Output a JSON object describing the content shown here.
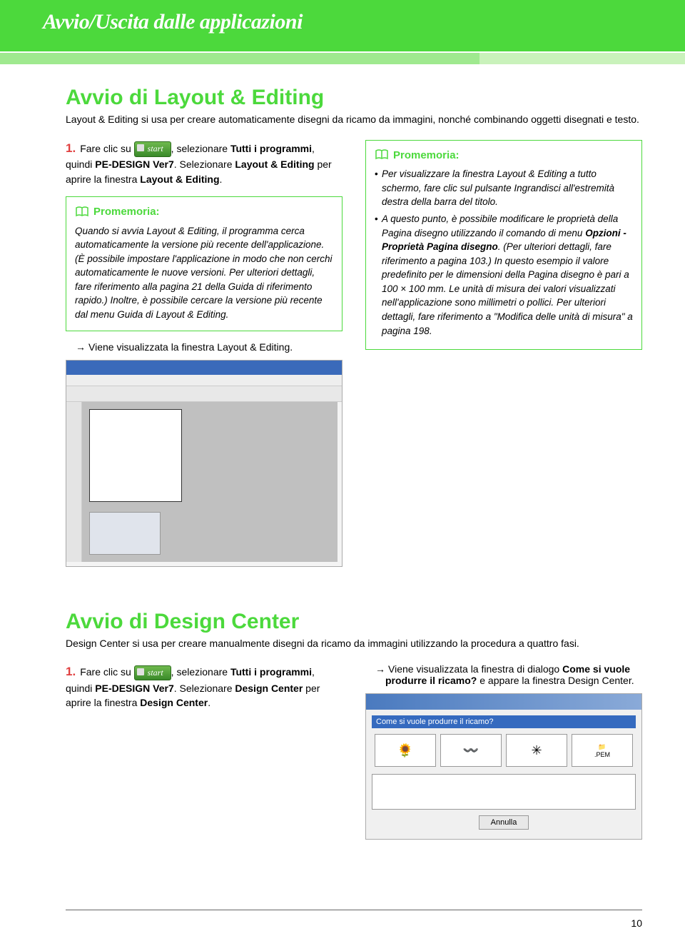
{
  "header": {
    "title": "Avvio/Uscita dalle applicazioni"
  },
  "sec1": {
    "heading": "Avvio di Layout & Editing",
    "intro": "Layout & Editing si usa per creare automaticamente disegni da ricamo da immagini, nonché combinando oggetti disegnati e testo.",
    "step_num": "1.",
    "step_a": "Fare clic su ",
    "start_label": "start",
    "step_b": ", selezionare ",
    "step_c": "Tutti i programmi",
    "step_d": ", quindi ",
    "step_e": "PE-DESIGN Ver7",
    "step_f": ". Selezionare ",
    "step_g": "Layout & Editing",
    "step_h": " per aprire la finestra ",
    "step_i": "Layout & Editing",
    "step_j": ".",
    "memo1_title": "Promemoria:",
    "memo1_body": "Quando si avvia Layout & Editing, il programma cerca automaticamente la versione più recente dell'applicazione. (È possibile impostare l'applicazione in modo che non cerchi automaticamente le nuove versioni. Per ulteriori dettagli, fare riferimento alla pagina 21 della Guida di riferimento rapido.) Inoltre, è possibile cercare la versione più recente dal menu Guida di Layout & Editing.",
    "result_arrow": "→",
    "result": "Viene visualizzata la finestra Layout & Editing.",
    "memo2_title": "Promemoria:",
    "memo2_li1a": "Per visualizzare la finestra Layout & Editing a tutto schermo, fare clic sul pulsante Ingrandisci all'estremità destra della barra del titolo.",
    "memo2_li2a": "A questo punto, è possibile modificare le proprietà della Pagina disegno utilizzando il comando di menu ",
    "memo2_li2b": "Opzioni - Proprietà Pagina disegno",
    "memo2_li2c": ". (Per ulteriori dettagli, fare riferimento a pagina 103.) In questo esempio il valore predefinito per le dimensioni della Pagina disegno è pari a 100 × 100 mm. Le unità di misura dei valori visualizzati nell'applicazione sono millimetri o pollici. Per ulteriori dettagli, fare riferimento a \"Modifica delle unità di misura\" a pagina 198."
  },
  "sec2": {
    "heading": "Avvio di Design Center",
    "intro": "Design Center si usa per creare manualmente disegni da ricamo da immagini utilizzando la procedura a quattro fasi.",
    "step_num": "1.",
    "step_a": "Fare clic su ",
    "start_label": "start",
    "step_b": ", selezionare ",
    "step_c": "Tutti i programmi",
    "step_d": ", quindi ",
    "step_e": "PE-DESIGN Ver7",
    "step_f": ". Selezionare ",
    "step_g": "Design Center",
    "step_h": " per aprire la finestra ",
    "step_i": "Design Center",
    "step_j": ".",
    "result_arrow": "→",
    "result_a": "Viene visualizzata la finestra di dialogo ",
    "result_b": "Come si vuole produrre il ricamo?",
    "result_c": " e appare la finestra Design Center.",
    "dialog_q": "Come si vuole produrre il ricamo?",
    "dialog_btn": "Annulla",
    "dialog_label": ".PEM"
  },
  "page": "10"
}
